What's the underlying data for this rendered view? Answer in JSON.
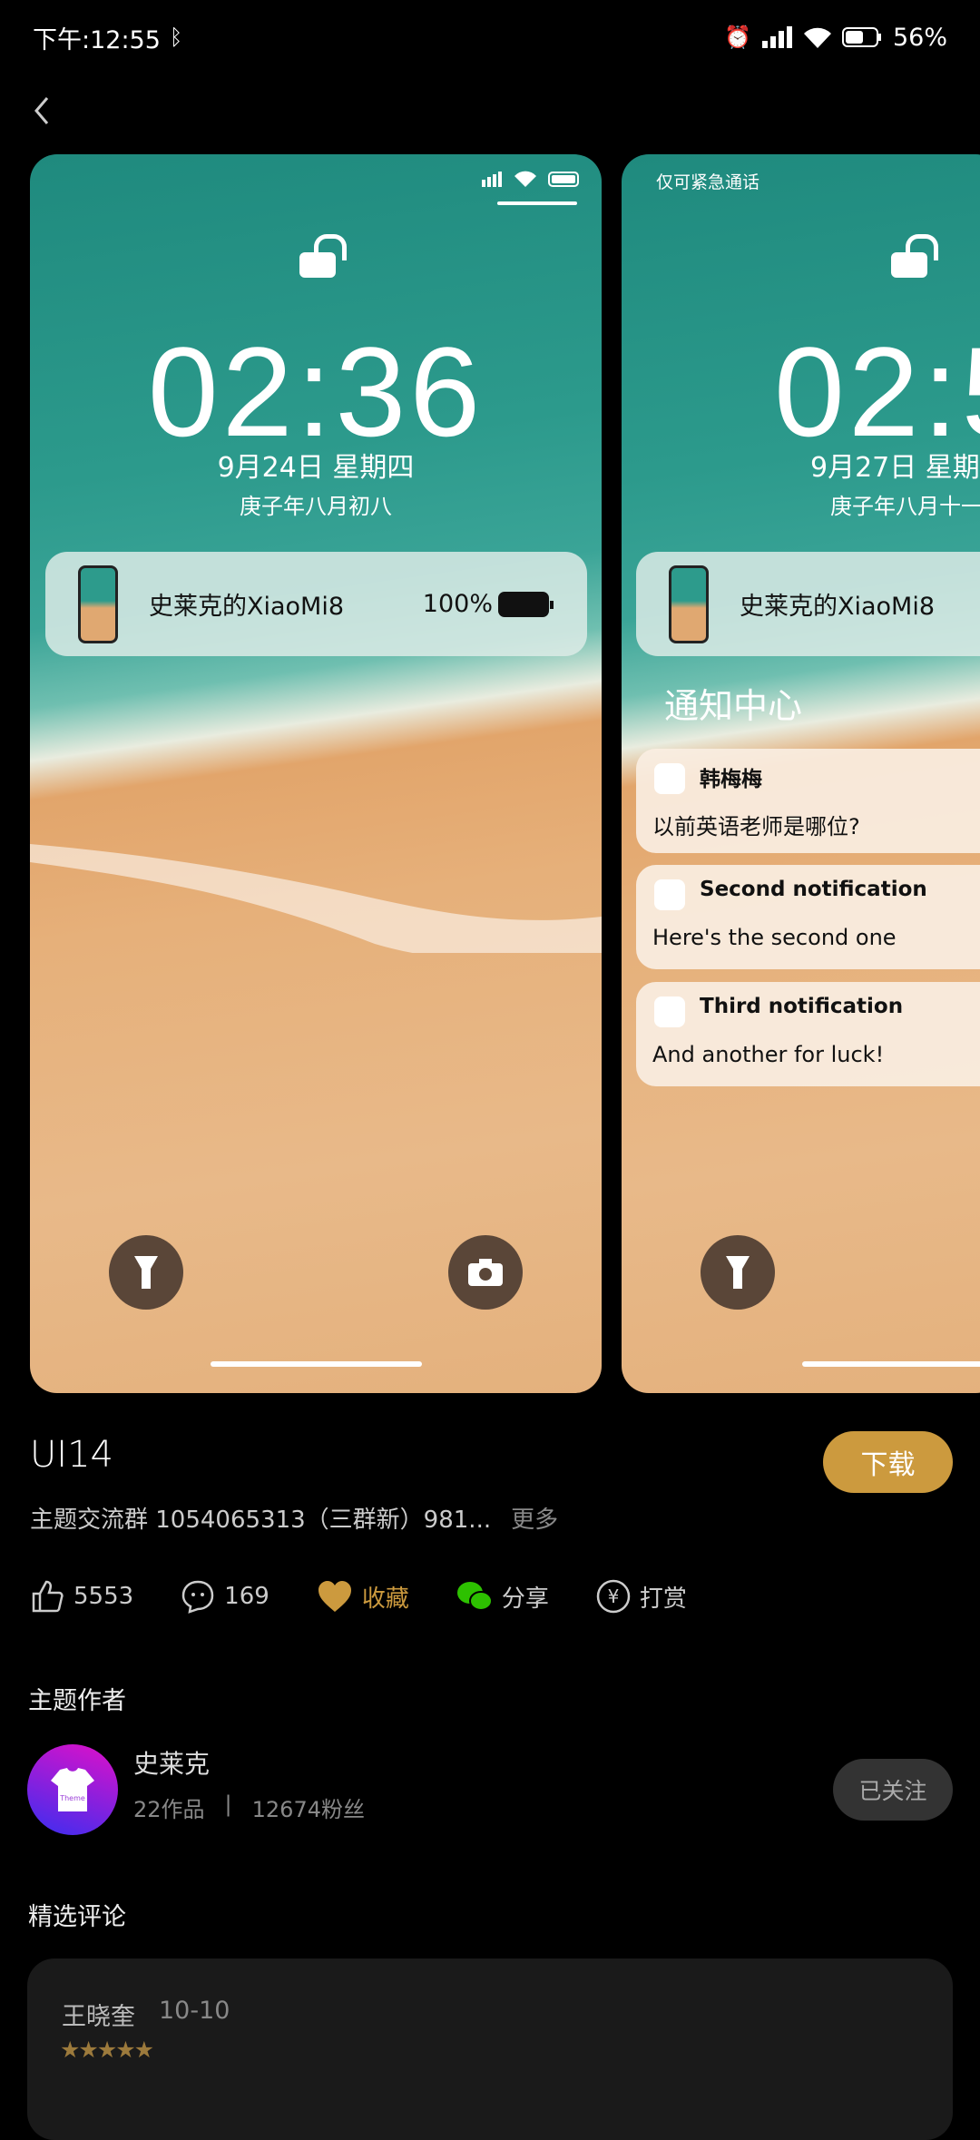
{
  "status_bar": {
    "time": "下午:12:55",
    "battery": "56%"
  },
  "previews": [
    {
      "clock": "02:36",
      "date": "9月24日 星期四",
      "lunar": "庚子年八月初八",
      "device": "史莱克的XiaoMi8",
      "battery": "100%"
    },
    {
      "carrier": "仅可紧急通话",
      "clock": "02:5",
      "date": "9月27日 星期",
      "lunar": "庚子年八月十一",
      "device": "史莱克的XiaoMi8",
      "notif_center": "通知中心",
      "notifications": [
        {
          "title": "韩梅梅",
          "body": "以前英语老师是哪位?"
        },
        {
          "title": "Second notification",
          "body": "Here's the second one"
        },
        {
          "title": "Third notification",
          "body": "And another for luck!"
        }
      ]
    }
  ],
  "theme": {
    "title": "UI14",
    "download": "下载",
    "description": "主题交流群 1054065313（三群新）981...",
    "more": "更多"
  },
  "actions": {
    "likes": "5553",
    "comments": "169",
    "favorite": "收藏",
    "share": "分享",
    "tip": "打赏"
  },
  "colors": {
    "accent": "#cc9a3e",
    "wechat": "#2dc100"
  },
  "author": {
    "section": "主题作者",
    "name": "史莱克",
    "works": "22作品",
    "fans": "12674粉丝",
    "follow": "已关注",
    "avatar_text": "Theme"
  },
  "comments": {
    "section": "精选评论",
    "items": [
      {
        "user": "王晓奎",
        "date": "10-10",
        "rating": 5
      }
    ]
  }
}
